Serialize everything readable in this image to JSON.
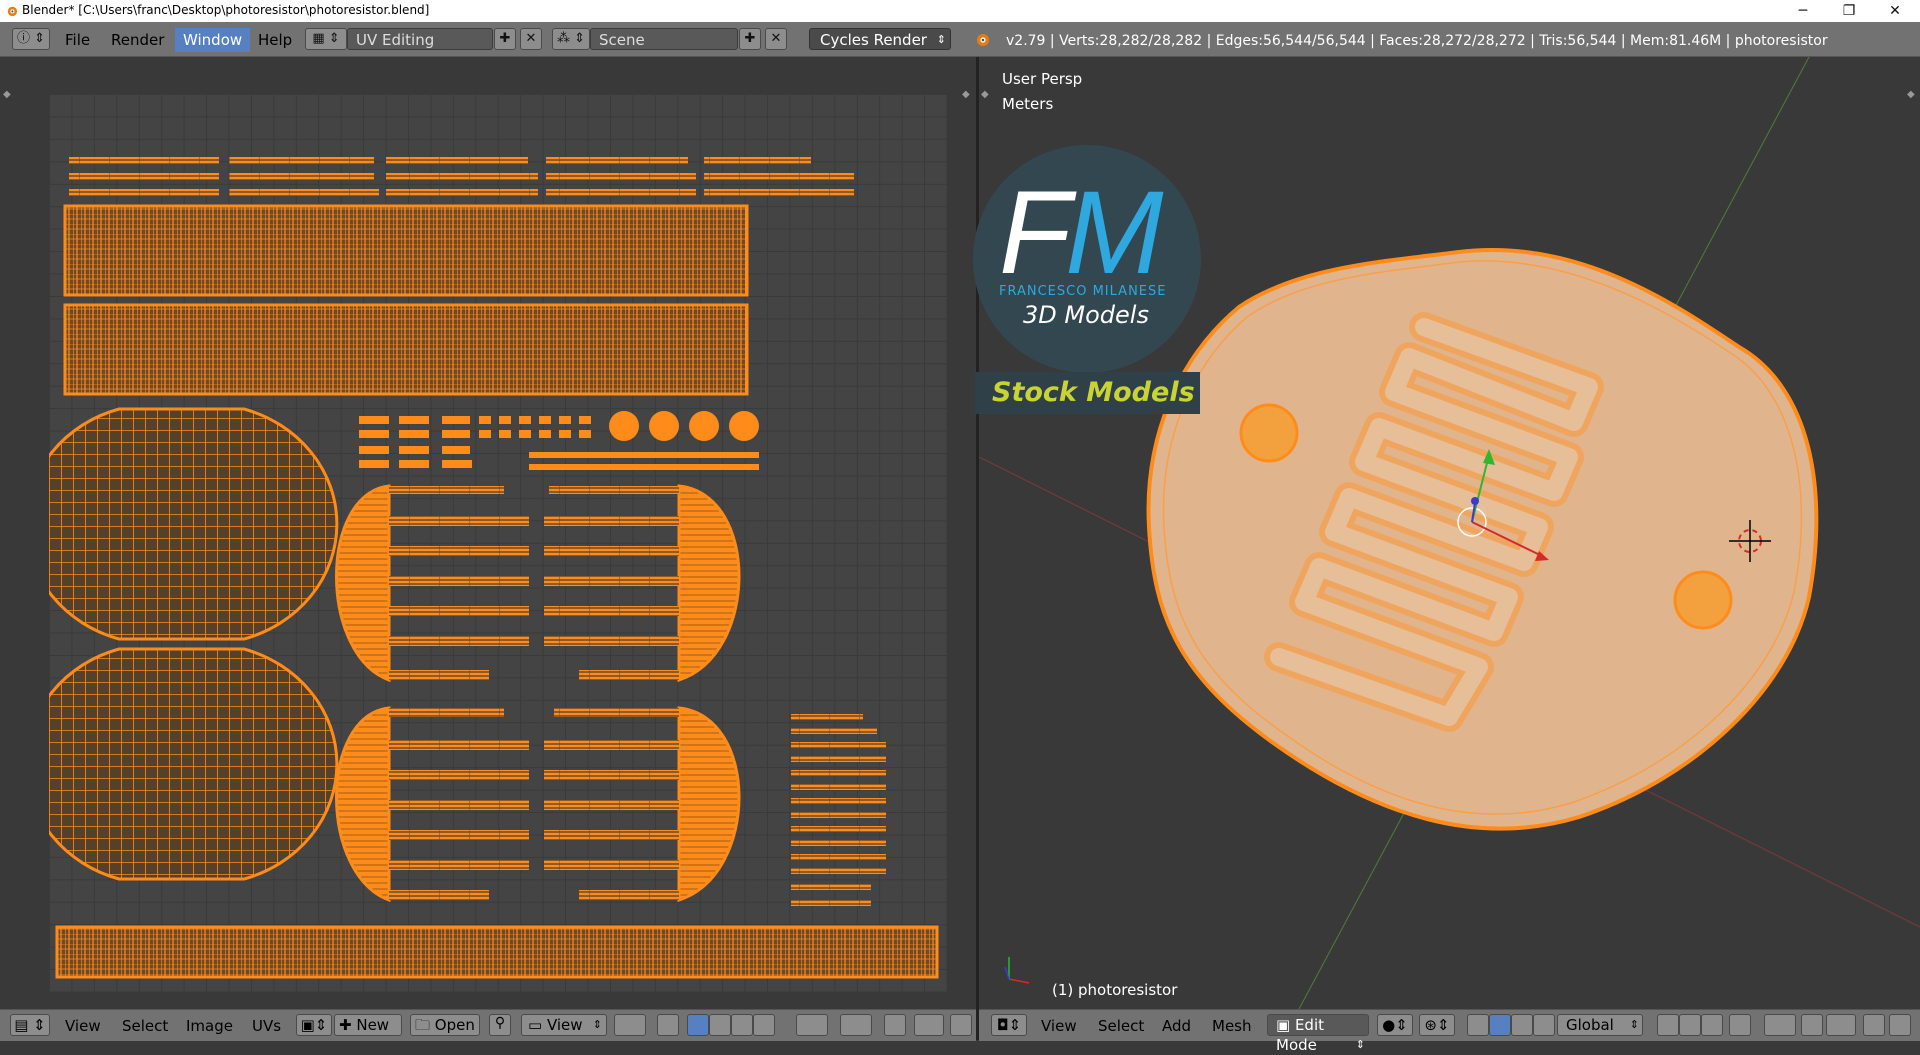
{
  "window": {
    "title": "Blender* [C:\\Users\\franc\\Desktop\\photoresistor\\photoresistor.blend]",
    "controls": [
      "─",
      "❐",
      "✕"
    ]
  },
  "topbar": {
    "menus": [
      "File",
      "Render",
      "Window",
      "Help"
    ],
    "active_menu": "Window",
    "layout": "UV Editing",
    "scene": "Scene",
    "engine": "Cycles Render",
    "stats": "v2.79 | Verts:28,282/28,282 | Edges:56,544/56,544 | Faces:28,272/28,272 | Tris:56,544 | Mem:81.46M | photoresistor"
  },
  "uv_editor": {
    "menus": [
      "View",
      "Select",
      "Image",
      "UVs"
    ],
    "new_label": "New",
    "open_label": "Open",
    "view_label": "View"
  },
  "viewport": {
    "persp_label": "User Persp",
    "units_label": "Meters",
    "object_label": "(1) photoresistor",
    "menus": [
      "View",
      "Select",
      "Add",
      "Mesh"
    ],
    "mode": "Edit Mode",
    "orientation": "Global",
    "logo": {
      "letters_f": "F",
      "letters_m": "M",
      "name": "FRANCESCO MILANESE",
      "subtitle": "3D Models",
      "banner": "Stock Models"
    }
  },
  "colors": {
    "uv_orange": "#ff8c1a",
    "mesh_fill": "#e0b58e",
    "menu_active": "#5680c2",
    "logo_blue": "#2ea8df",
    "banner_yellow": "#c9d434"
  }
}
